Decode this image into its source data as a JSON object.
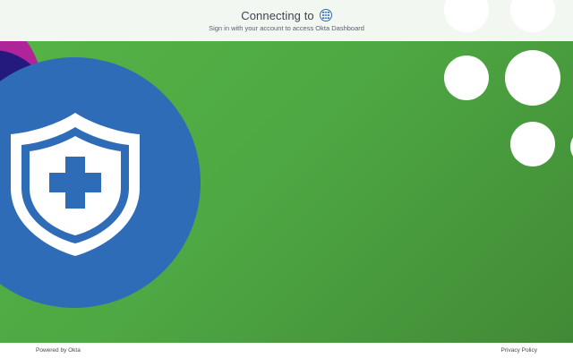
{
  "header": {
    "title": "Connecting to",
    "subtitle": "Sign in with your account to access Okta Dashboard",
    "app_icon": "grid-app-icon"
  },
  "hero": {
    "shield_icon": "shield-medical-cross-icon",
    "background_color": "#4ea843",
    "circle_color": "#2f6cb8",
    "accent_colors": [
      "#b0249a",
      "#241a7d"
    ]
  },
  "footer": {
    "powered_by": "Powered by Okta",
    "privacy_policy": "Privacy Policy"
  }
}
